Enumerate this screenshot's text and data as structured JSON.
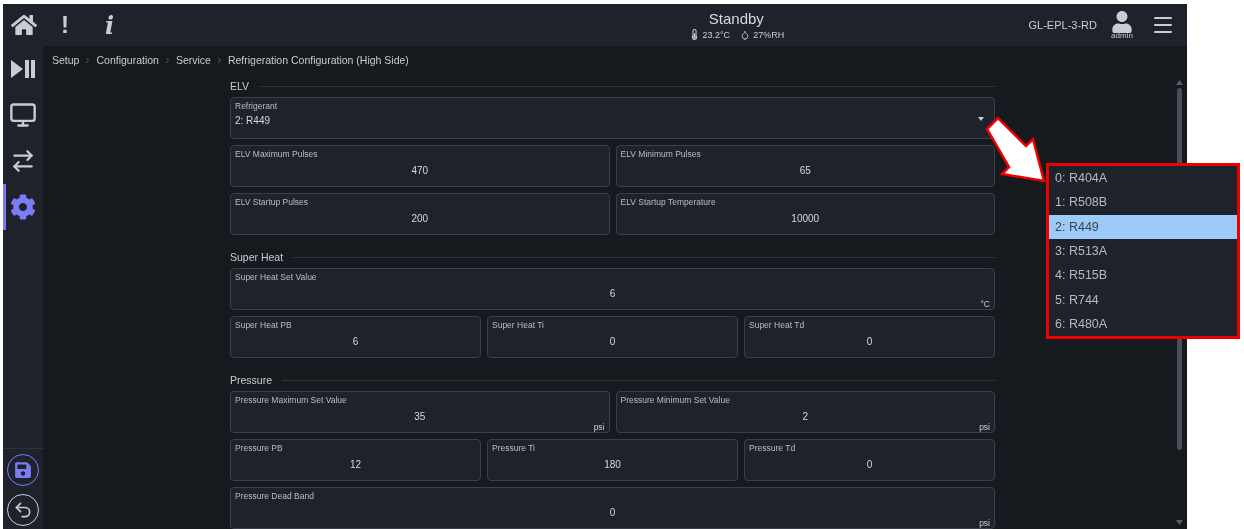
{
  "header": {
    "alert_glyph": "!",
    "info_glyph": "i",
    "title": "Standby",
    "temperature": "23.2°C",
    "humidity": "27%RH",
    "device": "GL-EPL-3-RD",
    "user": "admin"
  },
  "sidebar": {
    "items": [
      {
        "kind": "playpause",
        "selected": false
      },
      {
        "kind": "monitor",
        "selected": false
      },
      {
        "kind": "transfer",
        "selected": false
      },
      {
        "kind": "settings",
        "selected": true
      }
    ],
    "actions": [
      {
        "kind": "save"
      },
      {
        "kind": "back"
      }
    ]
  },
  "breadcrumb": [
    "Setup",
    "Configuration",
    "Service",
    "Refrigeration Configuration (High Side)"
  ],
  "sections": [
    {
      "title": "ELV",
      "field_groups": [
        {
          "fields": [
            {
              "kind": "select",
              "label": "Refrigerant",
              "value": "2: R449"
            }
          ]
        },
        {
          "fields": [
            {
              "kind": "number",
              "label": "ELV Maximum Pulses",
              "value": "470"
            },
            {
              "kind": "number",
              "label": "ELV Minimum Pulses",
              "value": "65"
            }
          ]
        },
        {
          "fields": [
            {
              "kind": "number",
              "label": "ELV Startup Pulses",
              "value": "200"
            },
            {
              "kind": "number",
              "label": "ELV Startup Temperature",
              "value": "10000"
            }
          ]
        }
      ]
    },
    {
      "title": "Super Heat",
      "field_groups": [
        {
          "fields": [
            {
              "kind": "number",
              "label": "Super Heat Set Value",
              "value": "6",
              "unit": "°C"
            }
          ]
        },
        {
          "fields": [
            {
              "kind": "number",
              "label": "Super Heat PB",
              "value": "6"
            },
            {
              "kind": "number",
              "label": "Super Heat Ti",
              "value": "0"
            },
            {
              "kind": "number",
              "label": "Super Heat Td",
              "value": "0"
            }
          ]
        }
      ]
    },
    {
      "title": "Pressure",
      "field_groups": [
        {
          "fields": [
            {
              "kind": "number",
              "label": "Pressure Maximum Set Value",
              "value": "35",
              "unit": "psi"
            },
            {
              "kind": "number",
              "label": "Pressure Minimum Set Value",
              "value": "2",
              "unit": "psi"
            }
          ]
        },
        {
          "fields": [
            {
              "kind": "number",
              "label": "Pressure PB",
              "value": "12"
            },
            {
              "kind": "number",
              "label": "Pressure Ti",
              "value": "180"
            },
            {
              "kind": "number",
              "label": "Pressure Td",
              "value": "0"
            }
          ]
        },
        {
          "fields": [
            {
              "kind": "number",
              "label": "Pressure Dead Band",
              "value": "0",
              "unit": "psi"
            }
          ]
        }
      ]
    }
  ],
  "dropdown": {
    "options": [
      {
        "label": "0: R404A",
        "selected": false
      },
      {
        "label": "1: R508B",
        "selected": false
      },
      {
        "label": "2: R449",
        "selected": true
      },
      {
        "label": "3: R513A",
        "selected": false
      },
      {
        "label": "4: R515B",
        "selected": false
      },
      {
        "label": "5: R744",
        "selected": false
      },
      {
        "label": "6: R480A",
        "selected": false
      }
    ]
  }
}
